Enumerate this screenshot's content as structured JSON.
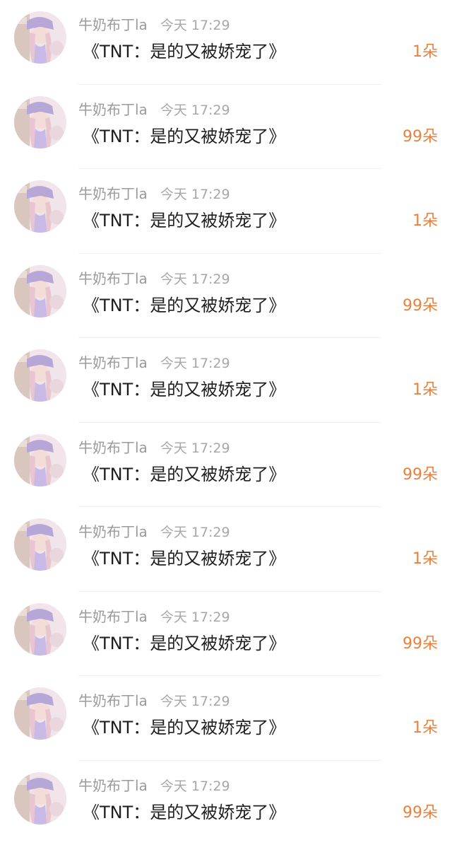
{
  "items": [
    {
      "user": "牛奶布丁la",
      "time": "今天 17:29",
      "title": "《TNT：是的又被娇宠了》",
      "count": "1朵"
    },
    {
      "user": "牛奶布丁la",
      "time": "今天 17:29",
      "title": "《TNT：是的又被娇宠了》",
      "count": "99朵"
    },
    {
      "user": "牛奶布丁la",
      "time": "今天 17:29",
      "title": "《TNT：是的又被娇宠了》",
      "count": "1朵"
    },
    {
      "user": "牛奶布丁la",
      "time": "今天 17:29",
      "title": "《TNT：是的又被娇宠了》",
      "count": "99朵"
    },
    {
      "user": "牛奶布丁la",
      "time": "今天 17:29",
      "title": "《TNT：是的又被娇宠了》",
      "count": "1朵"
    },
    {
      "user": "牛奶布丁la",
      "time": "今天 17:29",
      "title": "《TNT：是的又被娇宠了》",
      "count": "99朵"
    },
    {
      "user": "牛奶布丁la",
      "time": "今天 17:29",
      "title": "《TNT：是的又被娇宠了》",
      "count": "1朵"
    },
    {
      "user": "牛奶布丁la",
      "time": "今天 17:29",
      "title": "《TNT：是的又被娇宠了》",
      "count": "99朵"
    },
    {
      "user": "牛奶布丁la",
      "time": "今天 17:29",
      "title": "《TNT：是的又被娇宠了》",
      "count": "1朵"
    },
    {
      "user": "牛奶布丁la",
      "time": "今天 17:29",
      "title": "《TNT：是的又被娇宠了》",
      "count": "99朵"
    }
  ],
  "colors": {
    "count_accent": "#e8823b",
    "meta_gray": "#9b9b9b",
    "title_text": "#1e1e1e"
  },
  "icons": {
    "avatar": "user-avatar-photo"
  }
}
